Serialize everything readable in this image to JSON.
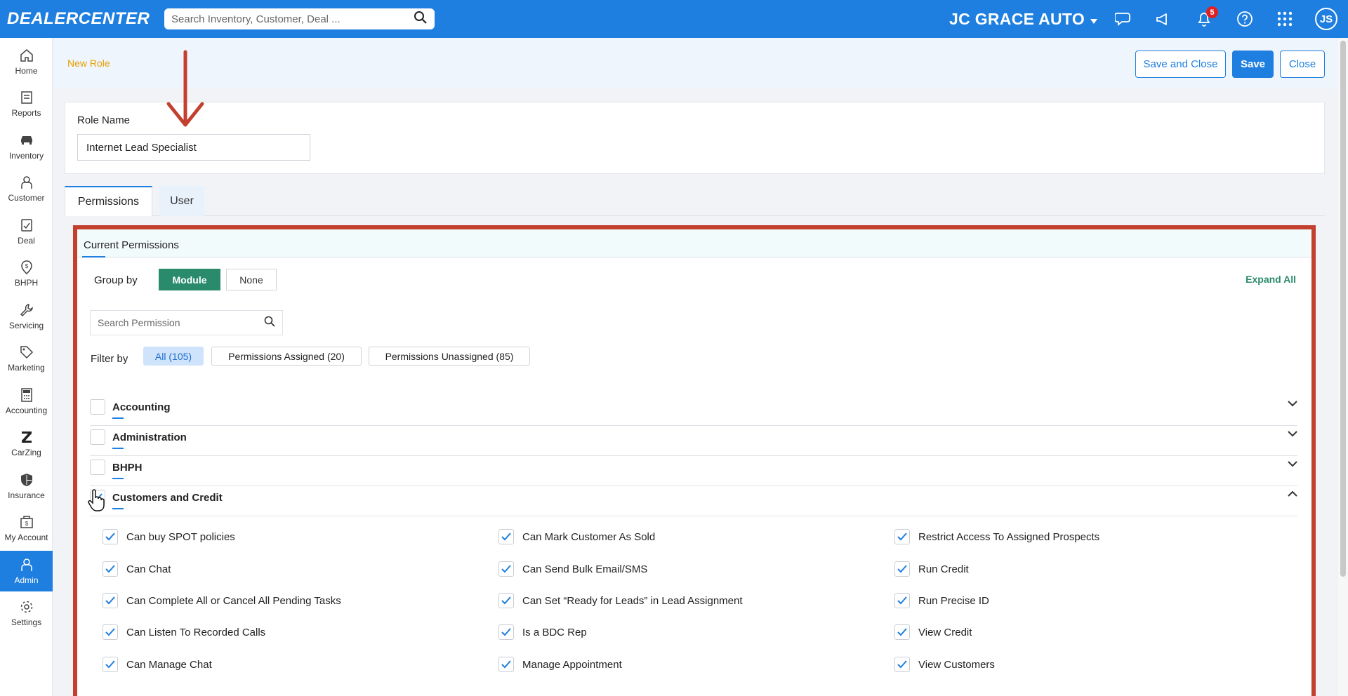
{
  "topbar": {
    "logo": "DEALERCENTER",
    "search_placeholder": "Search Inventory, Customer, Deal ...",
    "dealer_name": "JC GRACE AUTO",
    "notification_count": "5",
    "avatar_initials": "JS"
  },
  "sidebar": {
    "items": [
      {
        "label": "Home",
        "icon": "home-icon"
      },
      {
        "label": "Reports",
        "icon": "reports-icon"
      },
      {
        "label": "Inventory",
        "icon": "car-icon"
      },
      {
        "label": "Customer",
        "icon": "person-icon"
      },
      {
        "label": "Deal",
        "icon": "deal-icon"
      },
      {
        "label": "BHPH",
        "icon": "bhph-icon"
      },
      {
        "label": "Servicing",
        "icon": "wrench-icon"
      },
      {
        "label": "Marketing",
        "icon": "tag-icon"
      },
      {
        "label": "Accounting",
        "icon": "calculator-icon"
      },
      {
        "label": "CarZing",
        "icon": "carzing-icon"
      },
      {
        "label": "Insurance",
        "icon": "shield-icon"
      },
      {
        "label": "My Account",
        "icon": "account-icon"
      },
      {
        "label": "Admin",
        "icon": "admin-icon"
      },
      {
        "label": "Settings",
        "icon": "gear-icon"
      }
    ],
    "active": "Admin"
  },
  "header": {
    "breadcrumb": "New Role",
    "save_and_close": "Save and Close",
    "save": "Save",
    "close": "Close"
  },
  "role": {
    "label": "Role Name",
    "value": "Internet Lead Specialist"
  },
  "tabs": {
    "permissions": "Permissions",
    "user": "User"
  },
  "permissions": {
    "title": "Current Permissions",
    "group_by_label": "Group by",
    "group_by_module": "Module",
    "group_by_none": "None",
    "expand_all": "Expand All",
    "search_placeholder": "Search Permission",
    "filter_label": "Filter by",
    "filter_all": "All (105)",
    "filter_assigned": "Permissions Assigned (20)",
    "filter_unassigned": "Permissions Unassigned (85)",
    "groups": [
      {
        "name": "Accounting",
        "checked": false,
        "expanded": false
      },
      {
        "name": "Administration",
        "checked": false,
        "expanded": false
      },
      {
        "name": "BHPH",
        "checked": false,
        "expanded": false
      },
      {
        "name": "Customers and Credit",
        "checked": true,
        "expanded": true
      }
    ],
    "items": {
      "col1": [
        "Can buy SPOT policies",
        "Can Chat",
        "Can Complete All or Cancel All Pending Tasks",
        "Can Listen To Recorded Calls",
        "Can Manage Chat"
      ],
      "col2": [
        "Can Mark Customer As Sold",
        "Can Send Bulk Email/SMS",
        "Can Set “Ready for Leads” in Lead Assignment",
        "Is a BDC Rep",
        "Manage Appointment"
      ],
      "col3": [
        "Restrict Access To Assigned Prospects",
        "Run Credit",
        "Run Precise ID",
        "View Credit",
        "View Customers"
      ]
    }
  },
  "colors": {
    "brand_blue": "#1e7fe0",
    "green": "#2a8a6c",
    "annotation_red": "#c3402f",
    "breadcrumb_orange": "#e8a000"
  }
}
